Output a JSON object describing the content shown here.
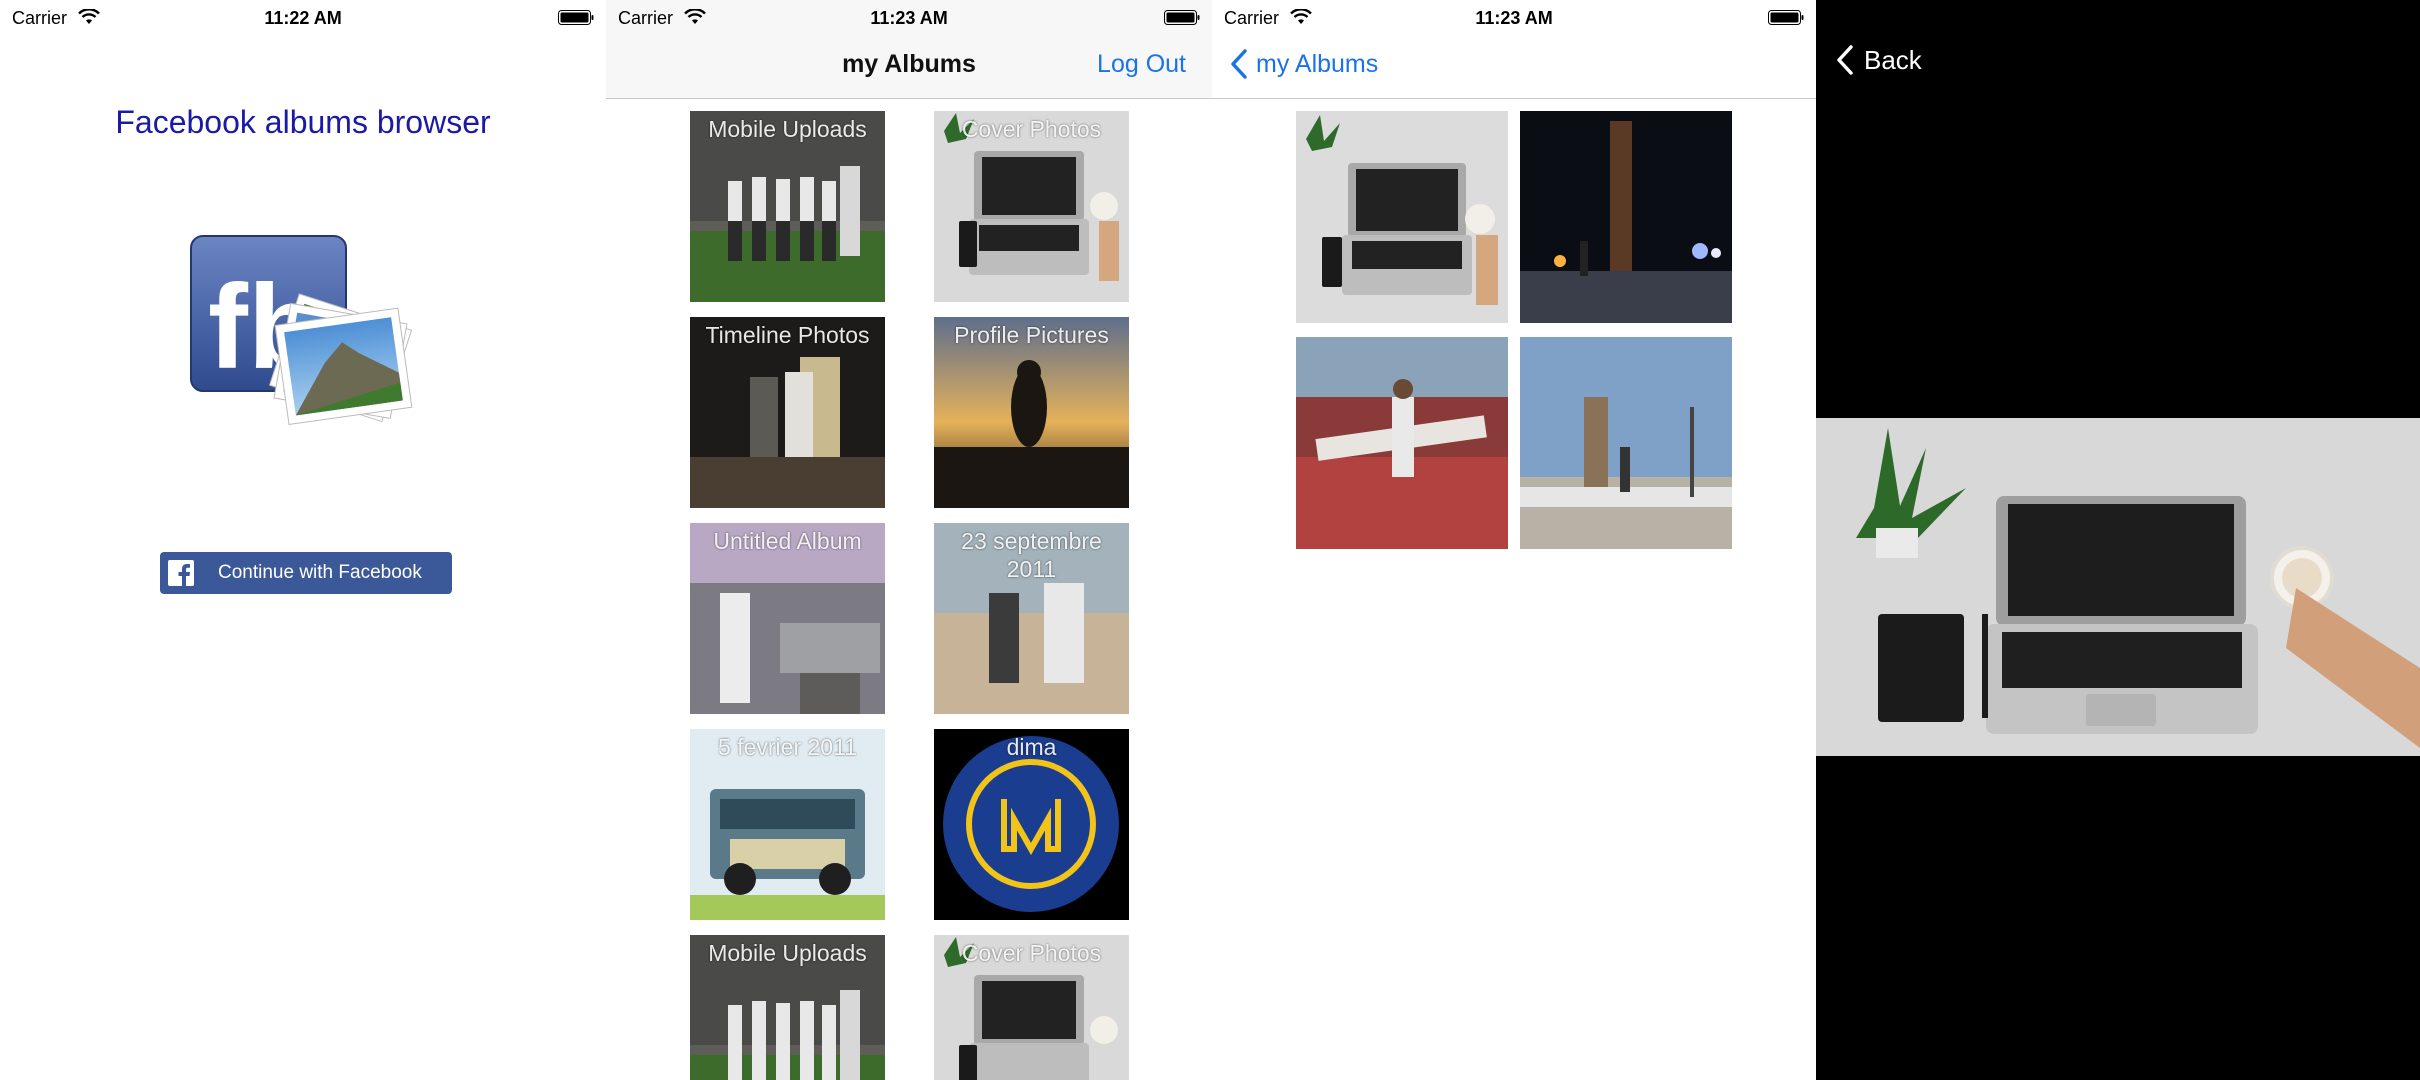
{
  "screens": {
    "login": {
      "status": {
        "carrier": "Carrier",
        "time": "11:22 AM"
      },
      "title": "Facebook albums browser",
      "logo_text": "fb",
      "fb_button_label": "Continue with Facebook"
    },
    "albums": {
      "status": {
        "carrier": "Carrier",
        "time": "11:23 AM"
      },
      "nav_title": "my Albums",
      "logout_label": "Log Out",
      "albums": [
        {
          "name": "Mobile Uploads"
        },
        {
          "name": "Cover Photos"
        },
        {
          "name": "Timeline Photos"
        },
        {
          "name": "Profile Pictures"
        },
        {
          "name": "Untitled Album"
        },
        {
          "name": "23 septembre 2011"
        },
        {
          "name": "5 fevrier 2011"
        },
        {
          "name": "dima"
        },
        {
          "name": "Mobile Uploads"
        },
        {
          "name": "Cover Photos"
        }
      ]
    },
    "photos": {
      "status": {
        "carrier": "Carrier",
        "time": "11:23 AM"
      },
      "back_label": "my Albums"
    },
    "viewer": {
      "back_label": "Back"
    }
  },
  "colors": {
    "accent": "#1a73e8",
    "facebook_blue": "#3b5998",
    "title_blue": "#1a1aa6"
  }
}
